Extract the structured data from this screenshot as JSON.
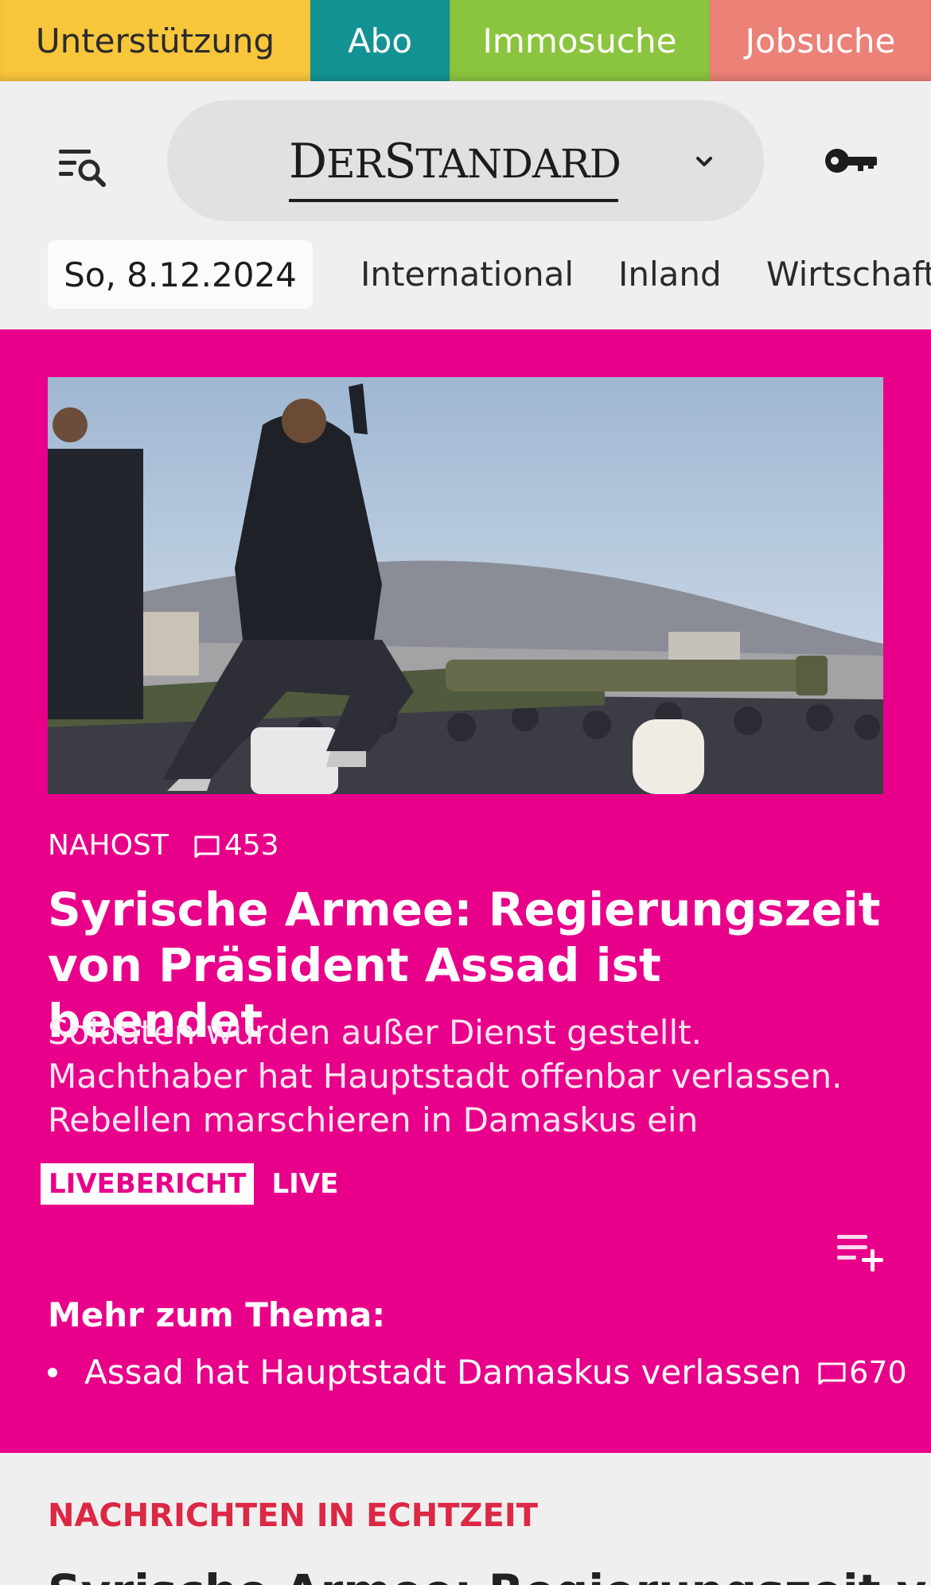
{
  "top_strip": {
    "support": "Unterstützung",
    "abo": "Abo",
    "immo": "Immosuche",
    "jobs": "Jobsuche"
  },
  "header": {
    "logo_text": "DerStandard",
    "menu_icon": "menu-search-icon",
    "account_icon": "key-icon",
    "dropdown_icon": "chevron-down-icon"
  },
  "nav": {
    "date": "So, 8.12.2024",
    "items": [
      "International",
      "Inland",
      "Wirtschaft"
    ]
  },
  "hero": {
    "kicker": "NAHOST",
    "comment_count": "453",
    "headline": "Syrische Armee: Regierungszeit von Präsident Assad ist beendet",
    "teaser": "Soldaten wurden außer Dienst gestellt. Machthaber hat Hauptstadt offenbar verlassen. Rebellen marschieren in Damaskus ein",
    "badge": "LIVEBERICHT",
    "live": "LIVE",
    "more_title": "Mehr zum Thema:",
    "related": [
      {
        "text": "Assad hat Hauptstadt Damaskus verlassen",
        "comments": "670"
      }
    ]
  },
  "section": {
    "title": "NACHRICHTEN IN ECHTZEIT",
    "next_headline": "Syrische Armee: Regierungszeit von Präsident Assad"
  },
  "colors": {
    "hero_pink": "#e8008a",
    "support": "#f8c63b",
    "abo": "#139293",
    "immo": "#8bc43e",
    "jobs": "#eb8177",
    "section_red": "#dc2745"
  }
}
